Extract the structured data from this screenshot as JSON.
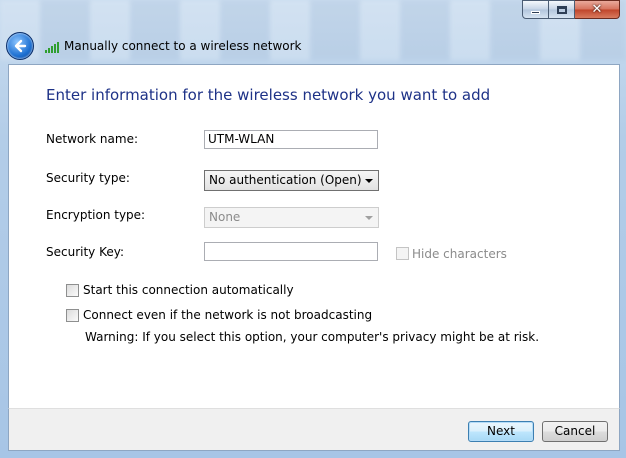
{
  "window": {
    "title": "Manually connect to a wireless network",
    "close_glyph": "✕"
  },
  "heading": "Enter information for the wireless network you want to add",
  "form": {
    "network_name": {
      "label": "Network name:",
      "value": "UTM-WLAN"
    },
    "security_type": {
      "label": "Security type:",
      "value": "No authentication (Open)"
    },
    "encryption_type": {
      "label": "Encryption type:",
      "value": "None"
    },
    "security_key": {
      "label": "Security Key:",
      "value": ""
    },
    "hide_characters": {
      "label": "Hide characters",
      "checked": false
    },
    "start_automatically": {
      "label": "Start this connection automatically",
      "checked": false
    },
    "connect_not_broadcasting": {
      "label": "Connect even if the network is not broadcasting",
      "checked": false
    },
    "warning": "Warning: If you select this option, your computer's privacy might be at risk."
  },
  "buttons": {
    "next": "Next",
    "cancel": "Cancel"
  },
  "icons": {
    "back": "back-arrow-icon",
    "network": "wireless-signal-icon"
  }
}
